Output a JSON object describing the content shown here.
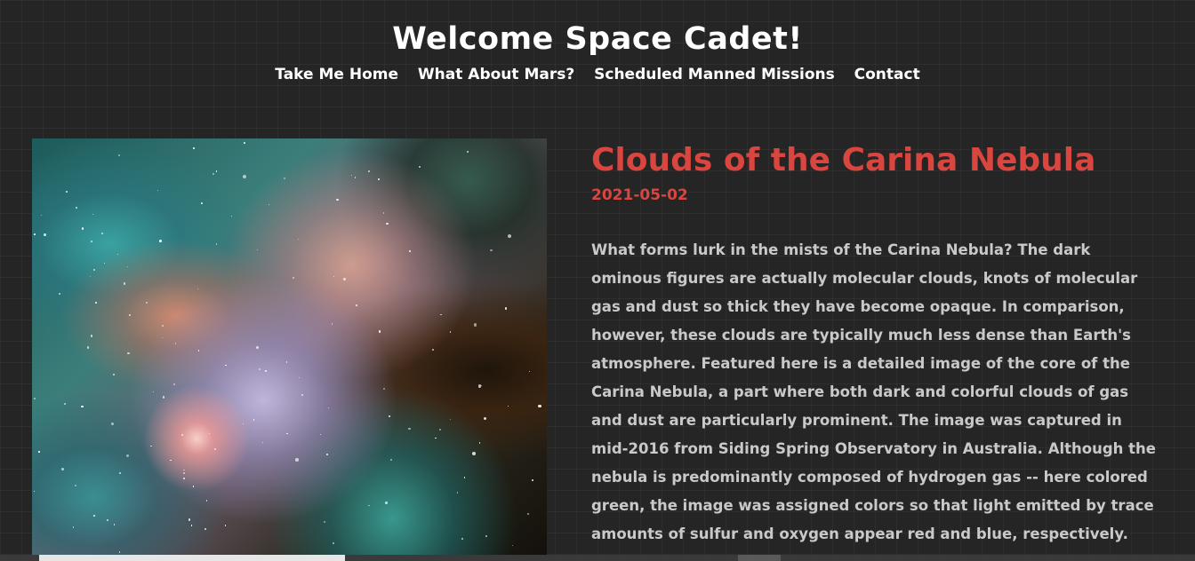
{
  "header": {
    "title": "Welcome Space Cadet!",
    "nav": [
      {
        "label": "Take Me Home"
      },
      {
        "label": "What About Mars?"
      },
      {
        "label": "Scheduled Manned Missions"
      },
      {
        "label": "Contact"
      }
    ]
  },
  "article": {
    "title": "Clouds of the Carina Nebula",
    "date": "2021-05-02",
    "body": "What forms lurk in the mists of the Carina Nebula? The dark ominous figures are actually molecular clouds, knots of molecular gas and dust so thick they have become opaque. In comparison, however, these clouds are typically much less dense than Earth's atmosphere. Featured here is a detailed image of the core of the Carina Nebula, a part where both dark and colorful clouds of gas and dust are particularly prominent. The image was captured in mid-2016 from Siding Spring Observatory in Australia. Although the nebula is predominantly composed of hydrogen gas -- here colored green, the image was assigned colors so that light emitted by trace amounts of sulfur and oxygen appear red and blue, respectively. The entire Carina Nebula,"
  },
  "colors": {
    "background": "#252525",
    "accent": "#d9453f",
    "body_text": "#c9c9c9",
    "header_text": "#ffffff"
  }
}
